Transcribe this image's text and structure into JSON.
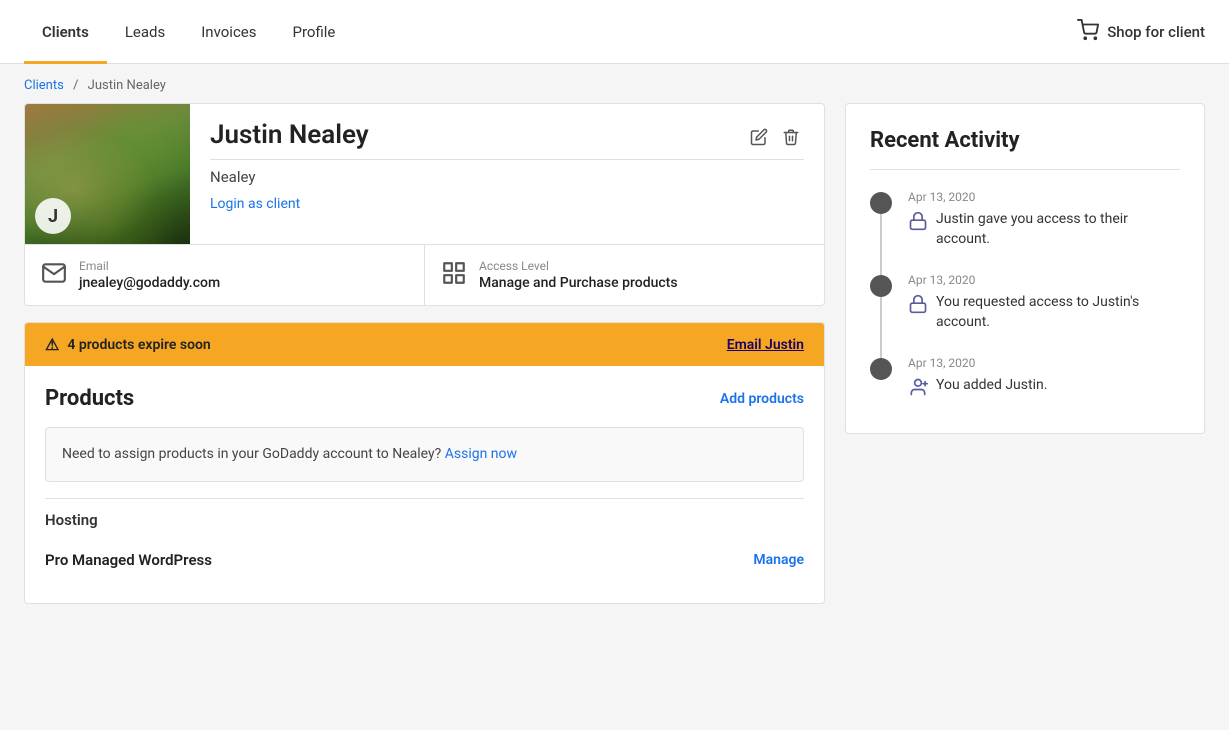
{
  "nav": {
    "links": [
      {
        "id": "clients",
        "label": "Clients",
        "active": true
      },
      {
        "id": "leads",
        "label": "Leads",
        "active": false
      },
      {
        "id": "invoices",
        "label": "Invoices",
        "active": false
      },
      {
        "id": "profile",
        "label": "Profile",
        "active": false
      }
    ],
    "shop_label": "Shop for client"
  },
  "breadcrumb": {
    "parent_label": "Clients",
    "current_label": "Justin Nealey"
  },
  "client": {
    "name": "Justin Nealey",
    "lastname": "Nealey",
    "avatar_letter": "J",
    "login_label": "Login as client",
    "email_label": "Email",
    "email_value": "jnealey@godaddy.com",
    "access_label": "Access Level",
    "access_value": "Manage and Purchase products"
  },
  "warning": {
    "text": "4 products expire soon",
    "link_label": "Email Justin"
  },
  "products": {
    "title": "Products",
    "add_label": "Add products",
    "assign_text": "Need to assign products in your GoDaddy account to Nealey?",
    "assign_link": "Assign now",
    "hosting_label": "Hosting",
    "items": [
      {
        "name": "Pro Managed WordPress",
        "action": "Manage"
      }
    ]
  },
  "activity": {
    "title": "Recent Activity",
    "items": [
      {
        "date": "Apr 13, 2020",
        "text": "Justin gave you access to their account.",
        "icon": "lock"
      },
      {
        "date": "Apr 13, 2020",
        "text": "You requested access to Justin's account.",
        "icon": "lock"
      },
      {
        "date": "Apr 13, 2020",
        "text": "You added Justin.",
        "icon": "person"
      }
    ]
  }
}
